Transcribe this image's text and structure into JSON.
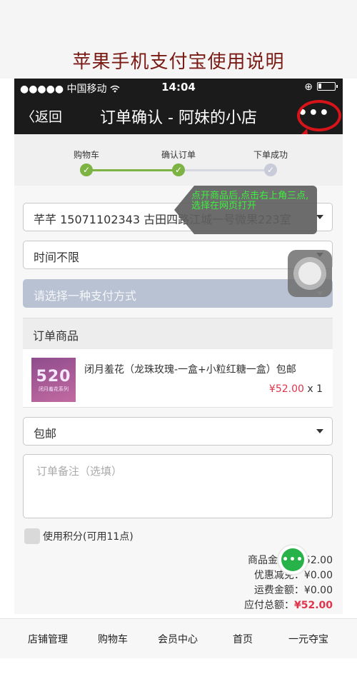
{
  "page_title": "苹果手机支付宝使用说明",
  "status_bar": {
    "left": "●●●●● 中国移动 ",
    "wifi_icon": "wifi-icon",
    "time": "14:04",
    "right": "⊕"
  },
  "nav": {
    "back_label": "〈返回",
    "title": "订单确认 - 阿妹的小店",
    "more_label": "•••"
  },
  "steps": [
    {
      "label": "购物车",
      "state": "done"
    },
    {
      "label": "确认订单",
      "state": "done"
    },
    {
      "label": "下单成功",
      "state": "pending"
    }
  ],
  "colors": {
    "step_done": "#7cb342",
    "step_pending": "#c8ccd8",
    "annotation_red": "#d8141b",
    "price_red": "#e0344c",
    "tooltip_text": "#3cf03c"
  },
  "address": "芊芊 15071102343 古田四路江城一号微果223室",
  "time_select": "时间不限",
  "payment_select_placeholder": "请选择一种支付方式",
  "tooltip_text": "点开商品后,点击右上角三点,选择在网页打开",
  "order_section_title": "订单商品",
  "product": {
    "thumb_number": "520",
    "thumb_sub": "闭月羞花系列",
    "name": "闭月羞花（龙珠玫瑰-一盒+小粒红糖一盒）包邮",
    "price": "¥52.00",
    "qty": " x 1"
  },
  "shipping_select": "包邮",
  "note_placeholder": "订单备注（选填）",
  "points_label": "使用积分(可用11点)",
  "summary": {
    "product_amount": "商品金额：¥52.00",
    "discount": "优惠减免：¥0.00",
    "shipping": "运费金额：¥0.00",
    "total_label": "应付总额：",
    "total_value": "¥52.00"
  },
  "chat_label": "•••",
  "tabs": [
    "店铺管理",
    "购物车",
    "会员中心",
    "首页",
    "一元夺宝"
  ]
}
